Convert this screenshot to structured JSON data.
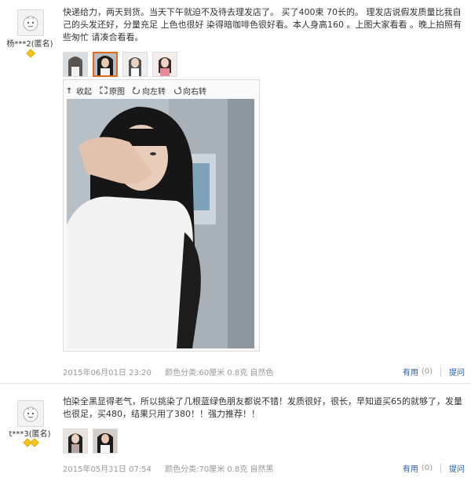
{
  "reviews": [
    {
      "username": "杨***2(匿名)",
      "text": "快递给力，两天到货。当天下午就迫不及待去理发店了。 买了400束 70长的。 理发店说假发质量比我自己的头发还好，分量充足 上色也很好 染得暗咖啡色很好看。本人身高160 。上图大家看看 。晚上拍照有些匆忙 请凑合看看。",
      "thumbnails": 4,
      "viewer": {
        "collapse_label": "收起",
        "original_label": "原图",
        "rotate_left_label": "向左转",
        "rotate_right_label": "向右转"
      },
      "date": "2015年06月01日 23:20",
      "attrs": "颜色分类:60厘米 0.8克 自然色",
      "useful_label": "有用",
      "useful_count": "(0)",
      "reply_label": "提问"
    },
    {
      "username": "t***3(匿名)",
      "text": "怕染全黑显得老气，所以挑染了几根蓝绿色朋友都说不错！发质很好，很长，早知道买65的就够了，发量也很足，买480，结果只用了380！！强力推荐！！",
      "thumbnails": 2,
      "date": "2015年05月31日 07:54",
      "attrs": "颜色分类:70厘米 0.8克 自然黑",
      "useful_label": "有用",
      "useful_count": "(0)",
      "reply_label": "提问"
    }
  ],
  "colors": {
    "link": "#2a5caa",
    "meta": "#999999",
    "badge": "#f7c520",
    "active_thumb": "#e46a1f"
  }
}
